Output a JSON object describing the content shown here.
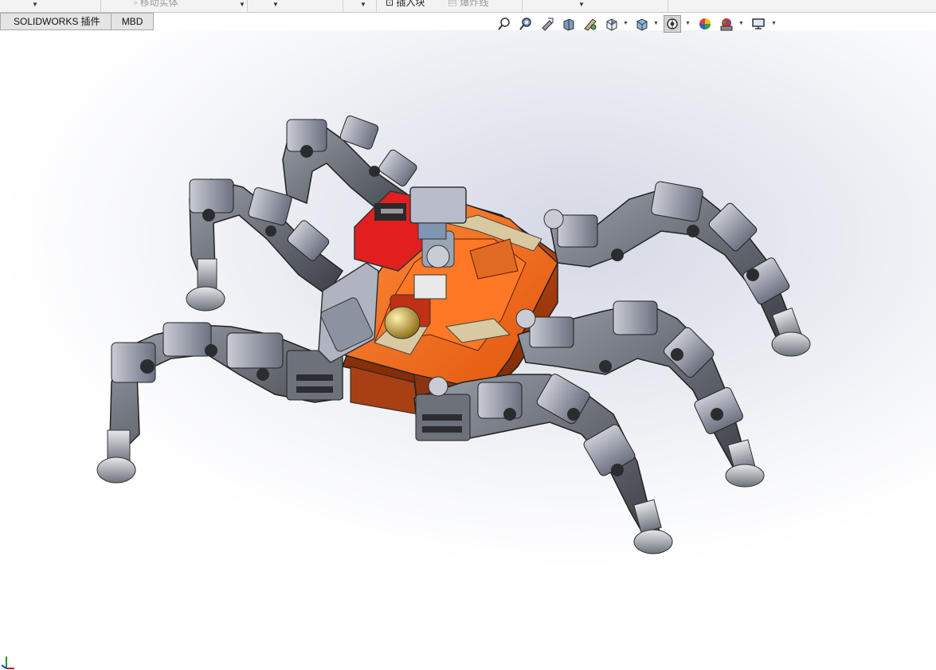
{
  "ribbon": {
    "items": [
      "移动实体",
      "插入块",
      "爆炸线"
    ]
  },
  "tabs": [
    {
      "label": "SOLIDWORKS 插件"
    },
    {
      "label": "MBD"
    }
  ],
  "view_toolbar": {
    "buttons": [
      "zoom-to-fit-icon",
      "zoom-to-area-icon",
      "previous-view-icon",
      "section-view-icon",
      "dynamic-annotation-icon",
      "view-orientation-icon",
      "display-style-icon",
      "hide-show-items-icon",
      "edit-appearance-icon",
      "apply-scene-icon",
      "view-settings-icon"
    ],
    "active": "hide-show-items-icon"
  },
  "model": {
    "name": "hexapod-robot-assembly",
    "colors": {
      "body": "#ff6a1a",
      "body_dark": "#b04010",
      "leg_link": "#5a5e66",
      "leg_plate": "#3c3f46",
      "servo": "#8d93a0",
      "foot": "#9aa0a8",
      "battery": "#e02020",
      "motor": "#c8a020",
      "tan_plate": "#d8c9a0"
    }
  },
  "triad": {
    "axis_x": "X",
    "axis_y": "Y",
    "axis_z": "Z"
  }
}
